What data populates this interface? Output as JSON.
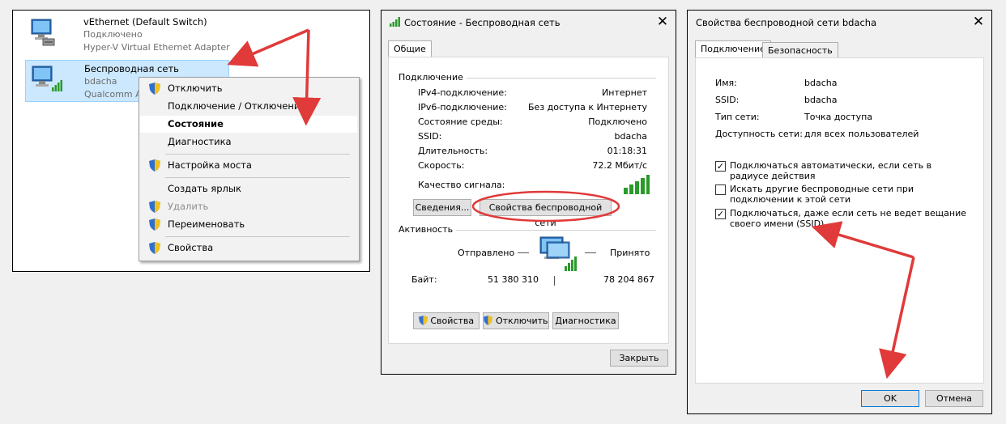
{
  "connections": {
    "items": [
      {
        "name": "vEthernet (Default Switch)",
        "status": "Подключено",
        "adapter": "Hyper-V Virtual Ethernet Adapter"
      },
      {
        "name": "Беспроводная сеть",
        "status": "bdacha",
        "adapter": "Qualcomm Athe"
      }
    ]
  },
  "context_menu": {
    "items": [
      {
        "label": "Отключить",
        "shield": true
      },
      {
        "label": "Подключение / Отключение",
        "shield": false
      },
      {
        "label": "Состояние",
        "shield": false,
        "bold": true
      },
      {
        "label": "Диагностика",
        "shield": false
      },
      {
        "label": "Настройка моста",
        "shield": true
      },
      {
        "label": "Создать ярлык",
        "shield": false
      },
      {
        "label": "Удалить",
        "shield": true,
        "disabled": true
      },
      {
        "label": "Переименовать",
        "shield": true
      },
      {
        "label": "Свойства",
        "shield": true
      }
    ]
  },
  "status_dialog": {
    "title": "Состояние - Беспроводная сеть",
    "close": "✕",
    "tab": "Общие",
    "connection_group": "Подключение",
    "rows": [
      {
        "k": "IPv4-подключение:",
        "v": "Интернет"
      },
      {
        "k": "IPv6-подключение:",
        "v": "Без доступа к Интернету"
      },
      {
        "k": "Состояние среды:",
        "v": "Подключено"
      },
      {
        "k": "SSID:",
        "v": "bdacha"
      },
      {
        "k": "Длительность:",
        "v": "01:18:31"
      },
      {
        "k": "Скорость:",
        "v": "72.2 Мбит/с"
      }
    ],
    "signal_label": "Качество сигнала:",
    "details_button": "Сведения...",
    "wireless_props_button": "Свойства беспроводной сети",
    "activity_group": "Активность",
    "sent_label": "Отправлено",
    "received_label": "Принято",
    "bytes_label": "Байт:",
    "bytes_sent": "51 380 310",
    "bytes_received": "78 204 867",
    "props_button": "Свойства",
    "disconnect_button": "Отключить",
    "diagnose_button": "Диагностика",
    "close_button": "Закрыть"
  },
  "props_dialog": {
    "title": "Свойства беспроводной сети bdacha",
    "close": "✕",
    "tabs": [
      "Подключение",
      "Безопасность"
    ],
    "fields": [
      {
        "k": "Имя:",
        "v": "bdacha"
      },
      {
        "k": "SSID:",
        "v": "bdacha"
      },
      {
        "k": "Тип сети:",
        "v": "Точка доступа"
      },
      {
        "k": "Доступность сети:",
        "v": "для всех пользователей"
      }
    ],
    "options": [
      {
        "label": "Подключаться автоматически, если сеть в радиусе действия",
        "checked": true
      },
      {
        "label": "Искать другие беспроводные сети при подключении к этой сети",
        "checked": false
      },
      {
        "label": "Подключаться, даже если сеть не ведет вещание своего имени (SSID)",
        "checked": true
      }
    ],
    "ok_button": "OK",
    "cancel_button": "Отмена"
  },
  "colors": {
    "annotation": "#e03a3a",
    "selection": "#cce8ff",
    "signal": "#2a9a2a"
  }
}
